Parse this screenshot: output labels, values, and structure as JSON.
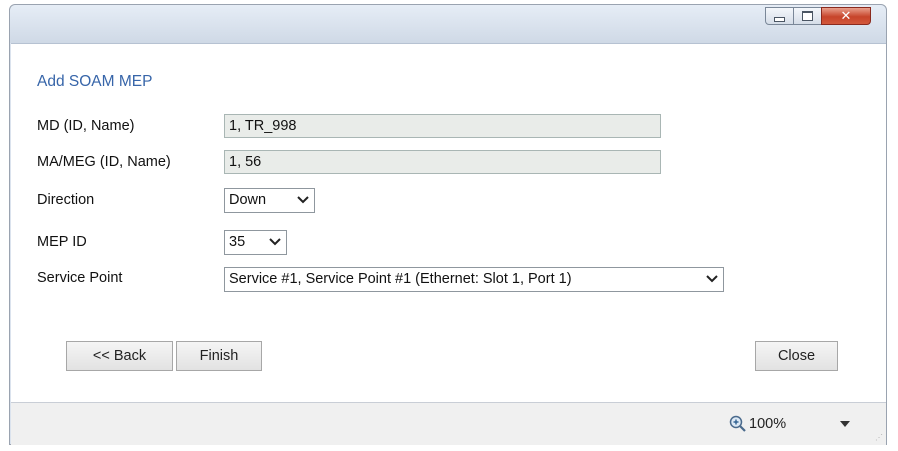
{
  "dialog": {
    "title": "Add SOAM MEP",
    "fields": {
      "md_label": "MD (ID, Name)",
      "md_value": "1, TR_998",
      "ma_label": "MA/MEG (ID, Name)",
      "ma_value": "1, 56",
      "direction_label": "Direction",
      "direction_value": "Down",
      "mep_id_label": "MEP ID",
      "mep_id_value": "35",
      "service_point_label": "Service Point",
      "service_point_value": "Service #1, Service Point #1 (Ethernet: Slot 1, Port 1)"
    },
    "buttons": {
      "back": "<< Back",
      "finish": "Finish",
      "close": "Close"
    }
  },
  "statusbar": {
    "zoom": "100%"
  },
  "icons": {
    "minimize": "minimize-icon",
    "maximize": "maximize-icon",
    "close": "close-icon",
    "zoom": "zoom-icon",
    "dropdown": "chevron-down-icon"
  },
  "colors": {
    "title_text": "#3765a9",
    "close_button": "#c7442a",
    "readonly_field": "#e9ece9"
  }
}
